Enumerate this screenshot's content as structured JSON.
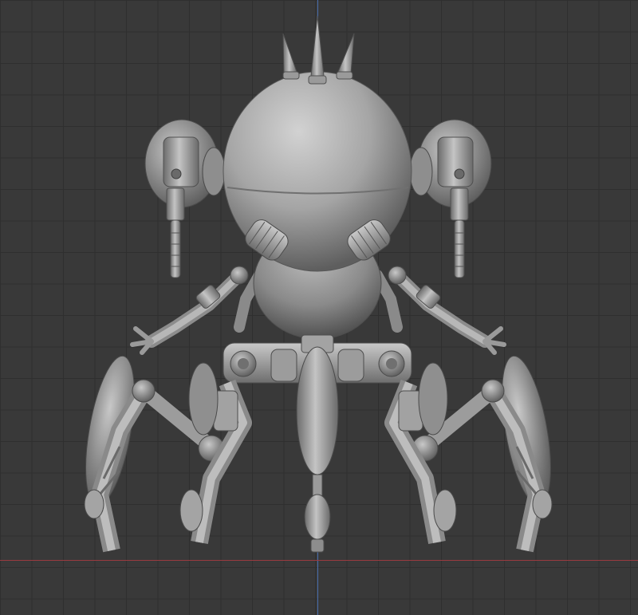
{
  "viewport": {
    "kind": "3d-viewport-orthographic",
    "object": "robot-sculpt",
    "grid": true,
    "axes": [
      "vertical-blue",
      "horizontal-red"
    ]
  },
  "colors": {
    "background": "#393939",
    "grid_line": "#2f2f2f",
    "axis_vertical": "#4a6fb0",
    "axis_horizontal": "#9a3a40",
    "model_light": "#b9b9b9",
    "model_mid": "#8f8f8f",
    "model_dark": "#555555"
  }
}
